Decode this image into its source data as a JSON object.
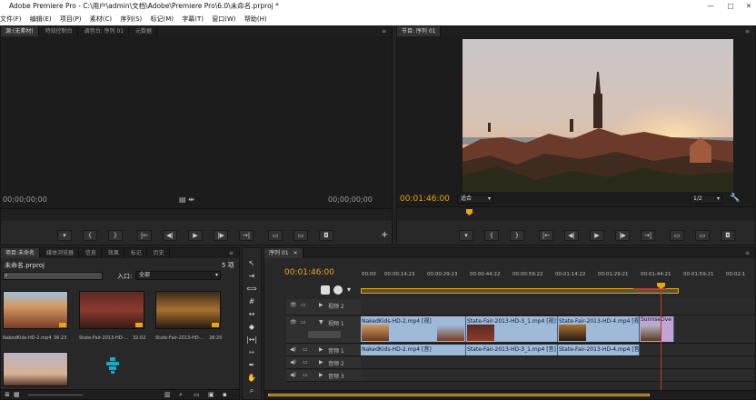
{
  "window": {
    "title": "Adobe Premiere Pro - C:\\用户\\admin\\文档\\Adobe\\Premiere Pro\\6.0\\未命名.prproj *",
    "controls": [
      "—",
      "□",
      "✕"
    ]
  },
  "menu": [
    "文件(F)",
    "编辑(E)",
    "项目(P)",
    "素材(C)",
    "序列(S)",
    "标记(M)",
    "字幕(T)",
    "窗口(W)",
    "帮助(H)"
  ],
  "source_panel": {
    "tabs": [
      "源:(无素材)",
      "特效控制台",
      "调音台: 序列 01",
      "元数据"
    ],
    "timecode_left": "00;00;00;00",
    "timecode_right": "00;00;00;00"
  },
  "program_panel": {
    "tab": "节目: 序列 01",
    "timecode": "00:01:46:00",
    "fit_value": "适合",
    "resolution": "1/2"
  },
  "project_panel": {
    "tabs": [
      "项目:未命名",
      "媒体浏览器",
      "信息",
      "效果",
      "标记",
      "历史"
    ],
    "project_name": "未命名.prproj",
    "item_count": "5 项",
    "in_label": "入口:",
    "in_value": "全部",
    "items": [
      {
        "name": "NakedKids-HD-2.mp4",
        "duration": "36:23"
      },
      {
        "name": "State-Fair-2013-HD-...",
        "duration": "32:02"
      },
      {
        "name": "State-Fair-2013-HD-...",
        "duration": "28:20"
      }
    ]
  },
  "timeline": {
    "tab": "序列 01",
    "timecode": "00:01:46:00",
    "ruler": [
      "00:00",
      "00:00:14:23",
      "00:00:29:23",
      "00:00:44:22",
      "00:00:59:22",
      "00:01:14:22",
      "00:01:29:21",
      "00:01:44:21",
      "00:01:59:21",
      "00:02:1"
    ],
    "tracks_video": [
      "视频 2",
      "视频 1"
    ],
    "tracks_audio": [
      "音频 1",
      "音频 2",
      "音频 3"
    ],
    "video_clips": [
      "NakedKids-HD-2.mp4 [视]",
      "State-Fair-2013-HD-3_1.mp4 [视]",
      "State-Fair-2013-HD-4.mp4 [视]",
      "SunnseOve"
    ],
    "audio_clips": [
      "NakedKids-HD-2.mp4 [音]",
      "State-Fair-2013-HD-3_1.mp4 [音]",
      "State-Fair-2013-HD-4.mp4 [音]"
    ]
  },
  "colors": {
    "accent_timecode": "#e8a317",
    "clip_blue": "#9fb9d9",
    "clip_pink": "#c3a3d6",
    "playhead": "#c0392b"
  }
}
